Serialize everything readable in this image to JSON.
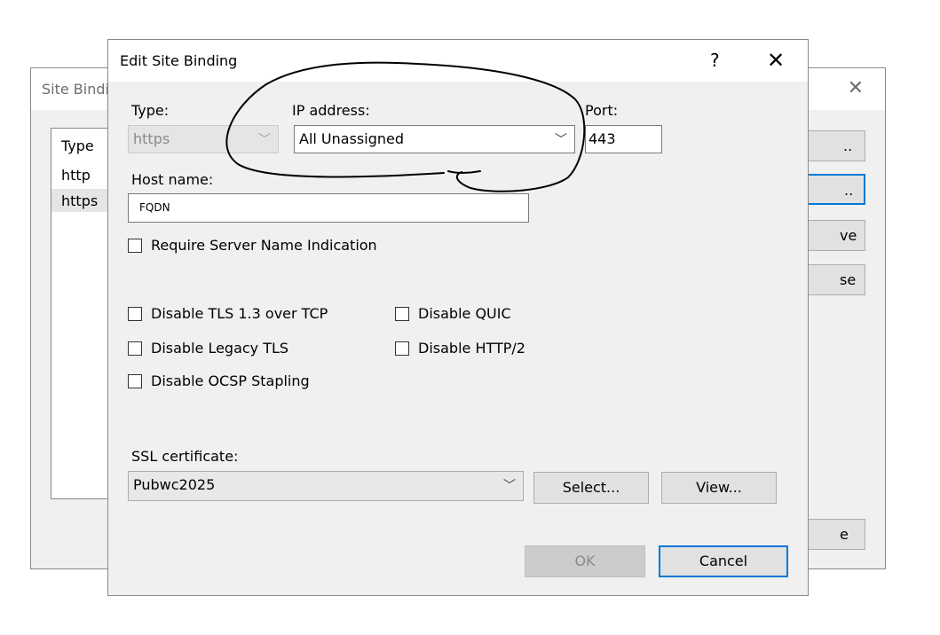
{
  "background_window": {
    "title": "Site Bindi",
    "close_glyph": "✕",
    "list_header": "Type",
    "list_rows": [
      "http",
      "https"
    ],
    "buttons": [
      "..",
      "..",
      "ve",
      "se",
      "e"
    ]
  },
  "dialog": {
    "title": "Edit Site Binding",
    "help_glyph": "?",
    "close_glyph": "✕",
    "type_label": "Type:",
    "type_value": "https",
    "ip_label": "IP address:",
    "ip_value": "All Unassigned",
    "port_label": "Port:",
    "port_value": "443",
    "host_label": "Host name:",
    "host_value": "FQDN",
    "sni_label": "Require Server Name Indication",
    "options_left": [
      "Disable TLS 1.3 over TCP",
      "Disable Legacy TLS",
      "Disable OCSP Stapling"
    ],
    "options_right": [
      "Disable QUIC",
      "Disable HTTP/2"
    ],
    "ssl_label": "SSL certificate:",
    "ssl_value": "Pubwc2025",
    "select_button": "Select...",
    "view_button": "View...",
    "ok_button": "OK",
    "cancel_button": "Cancel"
  },
  "icons": {
    "dropdown": "chevron-down-icon",
    "close": "close-icon",
    "help": "help-icon"
  }
}
